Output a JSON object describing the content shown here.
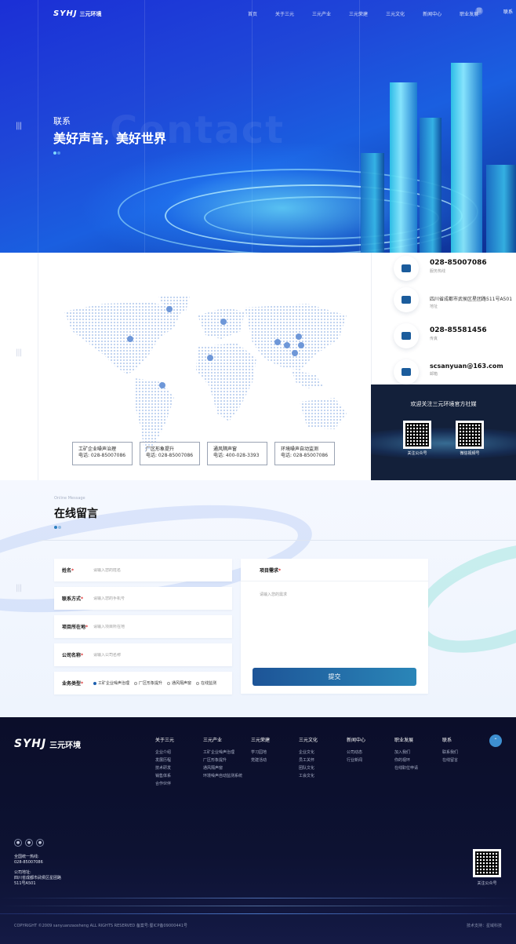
{
  "header": {
    "logo_mark": "SYHJ",
    "logo_text": "三元环境",
    "nav": [
      "首页",
      "关于三元",
      "三元产业",
      "三元荣建",
      "三元文化",
      "新闻中心",
      "职业发展"
    ],
    "nav_active": "联系"
  },
  "hero": {
    "ghost_text": "Contact",
    "subtitle": "联系",
    "title": "美好声音，美好世界"
  },
  "contact": {
    "offices": [
      {
        "name": "工矿企业噪声治理",
        "phone": "电话: 028-85007086"
      },
      {
        "name": "厂区形象提升",
        "phone": "电话: 028-85007086"
      },
      {
        "name": "通风隔声窗",
        "phone": "电话: 400-028-3393"
      },
      {
        "name": "环境噪声自动监测",
        "phone": "电话: 028-85007086"
      }
    ],
    "info": [
      {
        "icon": "phone-icon",
        "value": "028-85007086",
        "label": "服务热线"
      },
      {
        "icon": "location-icon",
        "value": "四川省成都市武侯区星团路511号A501",
        "label": "地址"
      },
      {
        "icon": "fax-icon",
        "value": "028-85581456",
        "label": "传真"
      },
      {
        "icon": "mail-icon",
        "value": "scsanyuan@163.com",
        "label": "邮箱"
      }
    ],
    "qr_title": "欢迎关注三元环境官方社媒",
    "qr_items": [
      {
        "caption": "关注公众号"
      },
      {
        "caption": "微信视频号"
      }
    ]
  },
  "message": {
    "label_en": "Online Message",
    "title": "在线留言",
    "fields": [
      {
        "label": "姓名",
        "placeholder": "请输入您的姓名"
      },
      {
        "label": "联系方式",
        "placeholder": "请输入您的手机号"
      },
      {
        "label": "项目所在地",
        "placeholder": "请输入项目所在地"
      },
      {
        "label": "公司名称",
        "placeholder": "请输入公司名称"
      }
    ],
    "type_label": "业务类型",
    "types": [
      "工矿企业噪声治理",
      "厂区形象提升",
      "通风隔声窗",
      "在线监测"
    ],
    "need_label": "项目需求",
    "need_placeholder": "请输入您的需求",
    "submit": "提交"
  },
  "footer": {
    "logo_mark": "SYHJ",
    "logo_text": "三元环境",
    "columns": [
      {
        "title": "关于三元",
        "items": [
          "企业介绍",
          "发展历程",
          "技术研发",
          "销售体系",
          "合作伙伴"
        ]
      },
      {
        "title": "三元产业",
        "items": [
          "工矿企业噪声治理",
          "厂区形象提升",
          "通风隔声窗",
          "环境噪声自动监测系统"
        ]
      },
      {
        "title": "三元荣建",
        "items": [
          "学习园地",
          "党建活动"
        ]
      },
      {
        "title": "三元文化",
        "items": [
          "企业文化",
          "员工关怀",
          "团队文化",
          "工会文化"
        ]
      },
      {
        "title": "新闻中心",
        "items": [
          "公司动态",
          "行业新闻"
        ]
      },
      {
        "title": "职业发展",
        "items": [
          "加入我们",
          "你的视环",
          "在线职位申请"
        ]
      },
      {
        "title": "联系",
        "items": [
          "联系我们",
          "在线留言"
        ]
      }
    ],
    "hotline_label": "全国统一热线:",
    "hotline": "028-85007086",
    "address_label": "公司地址:",
    "address_line1": "四川省成都市武侯区星团路",
    "address_line2": "511号A501",
    "qr_caption": "关注公众号",
    "copyright": "COPYRIGHT ©2009 sanyuanzaosheng ALL RIGHTS RESERVED  备案号:蜀ICP备09000441号",
    "links": "技术支持：星域科技"
  },
  "colors": {
    "brand_blue": "#1d5497",
    "hero_blue": "#1f47d8",
    "footer_bg": "#0b0e2a"
  }
}
